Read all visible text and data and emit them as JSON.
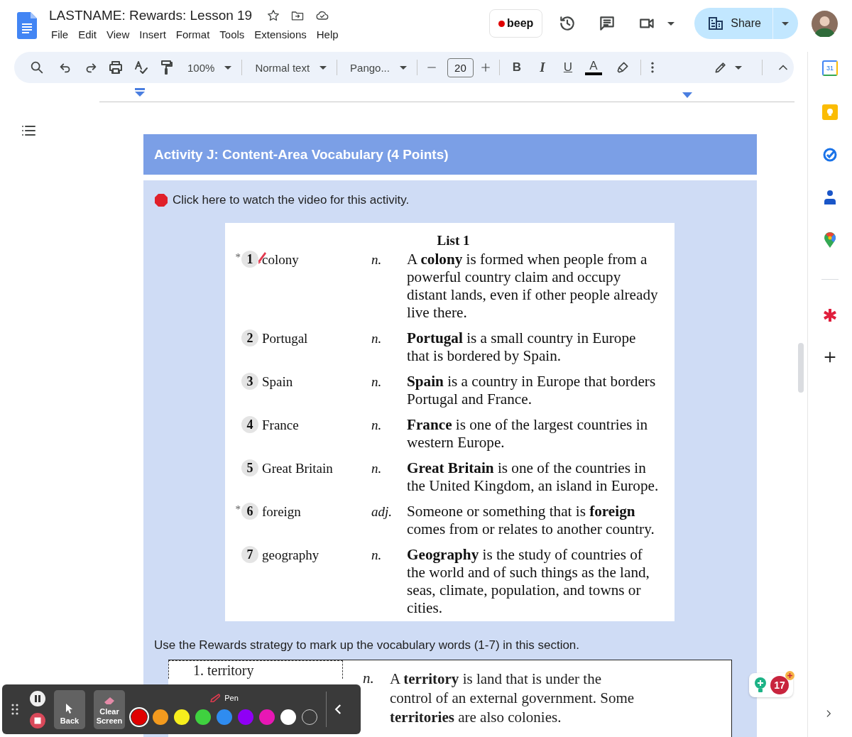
{
  "document": {
    "title": "LASTNAME: Rewards: Lesson 19"
  },
  "menu": [
    "File",
    "Edit",
    "View",
    "Insert",
    "Format",
    "Tools",
    "Extensions",
    "Help"
  ],
  "header": {
    "record_button": "beep",
    "share_button": "Share"
  },
  "toolbar": {
    "zoom": "100%",
    "style": "Normal text",
    "font": "Pango...",
    "font_size": "20",
    "format_buttons": [
      {
        "label": "B",
        "kind": "bold"
      },
      {
        "label": "I",
        "kind": "italic"
      },
      {
        "label": "U",
        "kind": "underline"
      },
      {
        "label": "A",
        "kind": "color"
      }
    ]
  },
  "side_panel": {
    "calendar_day": "31"
  },
  "activity": {
    "heading": "Activity J: Content-Area Vocabulary (4 Points)",
    "video_link": "Click here to watch the video for this activity.",
    "list": {
      "title": "List 1",
      "entries": [
        {
          "flag": "*",
          "number": "1",
          "word": "colony",
          "pen_mark": true,
          "pos": "n.",
          "definition": "A **colony** is formed when people from a powerful country claim and occupy distant lands, even if other people already live there."
        },
        {
          "number": "2",
          "word": "Portugal",
          "pen_mark": false,
          "pos": "n.",
          "definition": "**Portugal** is a small country in Europe that is bordered by Spain."
        },
        {
          "number": "3",
          "word": "Spain",
          "pen_mark": false,
          "pos": "n.",
          "definition": "**Spain** is a country in Europe that borders Portugal and France."
        },
        {
          "number": "4",
          "word": "France",
          "pen_mark": false,
          "pos": "n.",
          "definition": "**France** is one of the largest countries in western Europe."
        },
        {
          "number": "5",
          "word": "Great Britain",
          "pen_mark": false,
          "pos": "n.",
          "definition": "**Great Britain** is one of the countries in the United Kingdom, an island in Europe."
        },
        {
          "flag": "*",
          "number": "6",
          "word": "foreign",
          "pen_mark": false,
          "pos": "adj.",
          "definition": "Someone or something that is **foreign** comes from or relates to another country."
        },
        {
          "number": "7",
          "word": "geography",
          "pen_mark": false,
          "pos": "n.",
          "definition": "**Geography** is the study of countries of the world and of such things as the land, seas, climate, population, and towns or cities."
        }
      ]
    },
    "instruction": "Use the Rewards strategy to mark up the vocabulary words (1-7) in this section.",
    "next_entry": {
      "word": "1. territory",
      "pos": "n.",
      "definition": "A **territory** is land that is under the control of an external government. Some **territories** are also colonies."
    }
  },
  "annotation_toolbar": {
    "back": "Back",
    "clear": "Clear Screen",
    "tool": "Pen",
    "colors": [
      {
        "color": "#e00000",
        "selected": true
      },
      {
        "color": "#f39a1e",
        "selected": false
      },
      {
        "color": "#f7ee1d",
        "selected": false
      },
      {
        "color": "#3fd13f",
        "selected": false
      },
      {
        "color": "#2f8cf0",
        "selected": false
      },
      {
        "color": "#8f00f5",
        "selected": false
      },
      {
        "color": "#e817b4",
        "selected": false
      },
      {
        "color": "#ffffff",
        "selected": false
      },
      {
        "color": "#3a3a3a",
        "selected": false
      }
    ]
  },
  "notification_badge": "17"
}
